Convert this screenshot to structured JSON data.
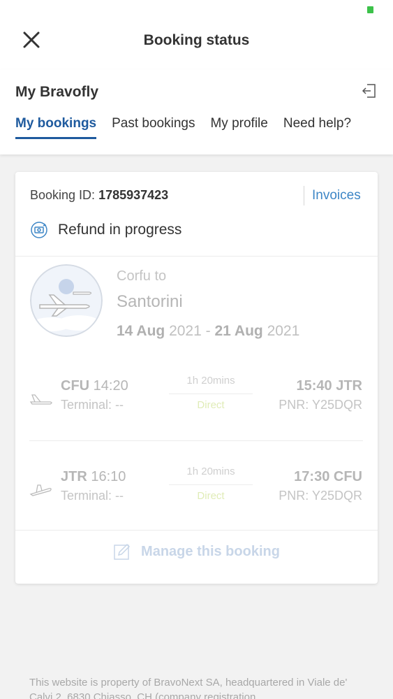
{
  "header": {
    "title": "Booking status"
  },
  "account": {
    "title": "My Bravofly",
    "tabs": [
      {
        "label": "My bookings",
        "active": true
      },
      {
        "label": "Past bookings",
        "active": false
      },
      {
        "label": "My profile",
        "active": false
      },
      {
        "label": "Need help?",
        "active": false
      }
    ]
  },
  "booking": {
    "id_label": "Booking ID:",
    "id_value": "1785937423",
    "invoices_label": "Invoices",
    "status": "Refund in progress",
    "route_from": "Corfu to",
    "route_to": "Santorini",
    "date_start_day": "14 Aug",
    "date_start_year": "2021",
    "date_sep": "-",
    "date_end_day": "21 Aug",
    "date_end_year": "2021",
    "legs": [
      {
        "dep_code": "CFU",
        "dep_time": "14:20",
        "terminal": "Terminal: --",
        "duration": "1h 20mins",
        "type": "Direct",
        "arr_time": "15:40",
        "arr_code": "JTR",
        "pnr": "PNR: Y25DQR"
      },
      {
        "dep_code": "JTR",
        "dep_time": "16:10",
        "terminal": "Terminal: --",
        "duration": "1h 20mins",
        "type": "Direct",
        "arr_time": "17:30",
        "arr_code": "CFU",
        "pnr": "PNR: Y25DQR"
      }
    ],
    "manage_label": "Manage this booking"
  },
  "footer": {
    "text": "This website is property of BravoNext SA, headquartered in Viale de' Calvi 2, 6830 Chiasso, CH (company registration"
  },
  "colors": {
    "accent": "#1e5a9e",
    "link": "#3d86c6",
    "background": "#f2f2f2"
  }
}
